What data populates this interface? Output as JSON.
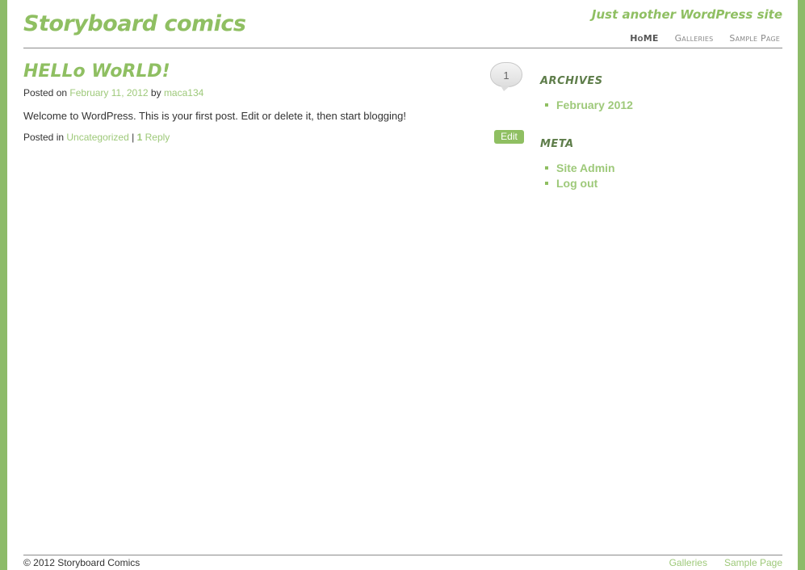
{
  "colors": {
    "accent": "#8fbf62",
    "background": "#8dbb69",
    "page": "#ffffff",
    "text": "#333333"
  },
  "header": {
    "site_title": "Storyboard comics",
    "tagline": "Just another WordPress site",
    "nav": [
      {
        "label": "HoME",
        "active": true
      },
      {
        "label": "Galleries",
        "active": false
      },
      {
        "label": "Sample Page",
        "active": false
      }
    ]
  },
  "post": {
    "title": "HELLo WoRLD!",
    "posted_on_prefix": "Posted on",
    "date": "February 11, 2012",
    "by_label": "by",
    "author": "maca134",
    "comment_count": "1",
    "body": "Welcome to WordPress. This is your first post. Edit or delete it, then start blogging!",
    "posted_in_prefix": "Posted in",
    "category": "Uncategorized",
    "separator": "|",
    "reply_count": "1",
    "reply_label": "Reply",
    "edit_label": "Edit"
  },
  "sidebar": {
    "archives_title": "ARCHIVES",
    "archives": [
      "February 2012"
    ],
    "meta_title": "META",
    "meta": [
      "Site Admin",
      "Log out"
    ]
  },
  "footer": {
    "copyright": "© 2012 Storyboard Comics",
    "links": [
      "Galleries",
      "Sample Page"
    ]
  }
}
